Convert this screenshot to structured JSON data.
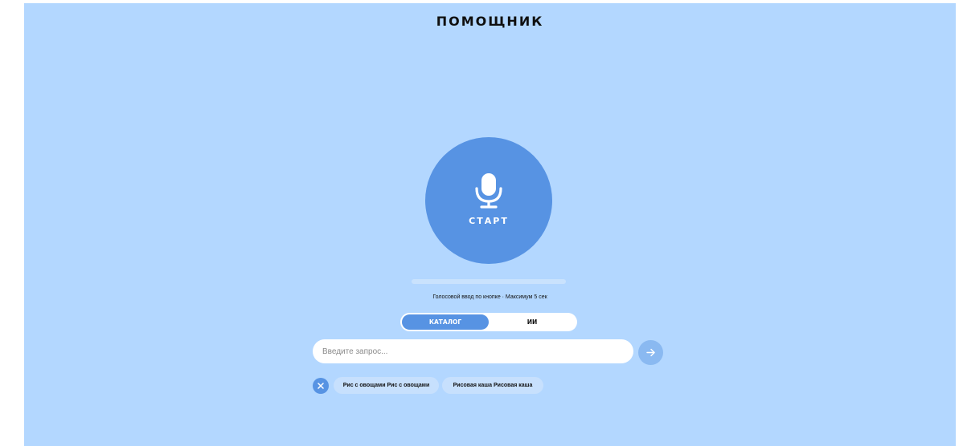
{
  "header": {
    "title": "ПОМОЩНИК"
  },
  "voice": {
    "start_label": "СТАРТ",
    "hint": "Голосовой ввод по кнопке · Максимум 5 сек",
    "progress_fraction": 0
  },
  "mode_toggle": {
    "tabs": [
      {
        "label": "КАТАЛОГ",
        "active": true
      },
      {
        "label": "ИИ",
        "active": false
      }
    ]
  },
  "search": {
    "placeholder": "Введите запрос...",
    "value": ""
  },
  "suggestions": {
    "chips": [
      {
        "label": "Рис с овощами Рис с овощами"
      },
      {
        "label": "Рисовая каша Рисовая каша"
      }
    ]
  },
  "colors": {
    "background": "#b3d7ff",
    "accent": "#5793e3",
    "send_button": "#8ab9f1",
    "chip": "#c7e0fd"
  },
  "icons": {
    "mic": "microphone-icon",
    "send": "arrow-right-icon",
    "clear": "close-icon"
  }
}
